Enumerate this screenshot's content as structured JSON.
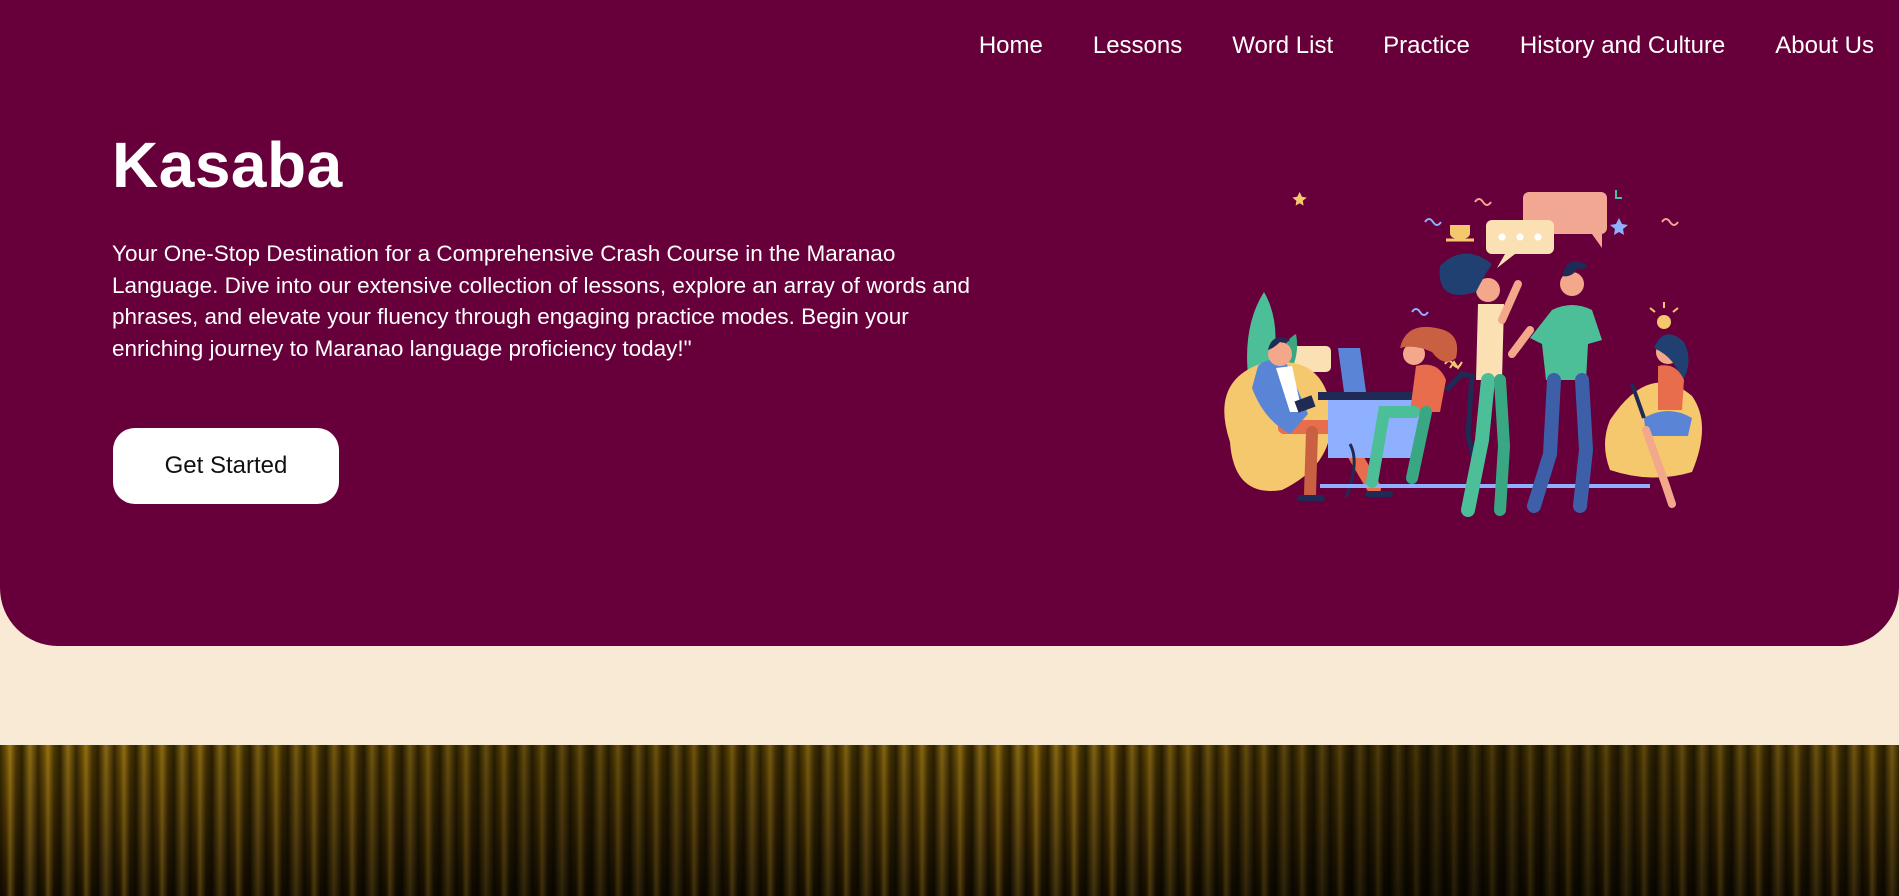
{
  "nav": {
    "items": [
      {
        "label": "Home"
      },
      {
        "label": "Lessons"
      },
      {
        "label": "Word List"
      },
      {
        "label": "Practice"
      },
      {
        "label": "History and Culture"
      },
      {
        "label": "About Us"
      }
    ]
  },
  "hero": {
    "title": "Kasaba",
    "tagline": "Your One-Stop Destination for a Comprehensive Crash Course in the Maranao Language. Dive into our extensive collection of lessons, explore an array of words and phrases, and elevate your fluency through engaging practice modes. Begin your enriching journey to Maranao language proficiency today!\"",
    "cta_label": "Get Started",
    "illustration": "people-chatting-illustration"
  },
  "colors": {
    "hero_bg": "#67003a",
    "page_bg": "#f9ead6",
    "accent_teal": "#4cbf98",
    "accent_yellow": "#f6c86e",
    "accent_pink": "#f2a793"
  }
}
